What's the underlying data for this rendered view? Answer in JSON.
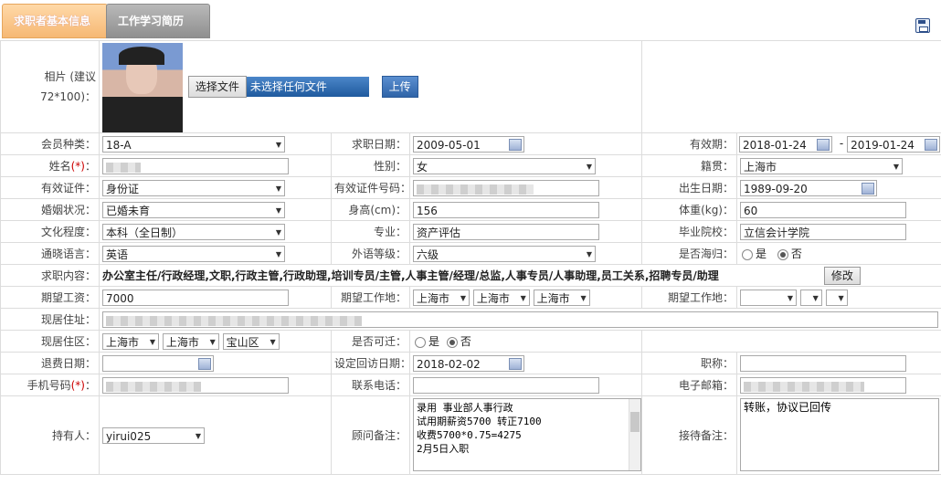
{
  "tabs": [
    {
      "label": "求职者基本信息"
    },
    {
      "label": "工作学习简历"
    }
  ],
  "photo": {
    "label": "相片 (建议",
    "label2": "72*100)：",
    "choose_file": "选择文件",
    "no_file": "未选择任何文件",
    "upload": "上传"
  },
  "fields": {
    "member_type": {
      "label": "会员种类：",
      "value": "18-A"
    },
    "apply_date": {
      "label": "求职日期：",
      "value": "2009-05-01"
    },
    "valid_period": {
      "label": "有效期：",
      "from": "2018-01-24",
      "sep": "-",
      "to": "2019-01-24"
    },
    "name": {
      "label": "姓名",
      "req": "(*)",
      "colon": "："
    },
    "gender": {
      "label": "性别：",
      "value": "女"
    },
    "origin": {
      "label": "籍贯：",
      "value": "上海市"
    },
    "id_type": {
      "label": "有效证件：",
      "value": "身份证"
    },
    "id_number": {
      "label": "有效证件号码："
    },
    "birth": {
      "label": "出生日期：",
      "value": "1989-09-20"
    },
    "marital": {
      "label": "婚姻状况：",
      "value": "已婚未育"
    },
    "height": {
      "label": "身高(cm)：",
      "value": "156"
    },
    "weight": {
      "label": "体重(kg)：",
      "value": "60"
    },
    "education": {
      "label": "文化程度：",
      "value": "本科（全日制）"
    },
    "major": {
      "label": "专业：",
      "value": "资产评估"
    },
    "school": {
      "label": "毕业院校：",
      "value": "立信会计学院"
    },
    "language": {
      "label": "通晓语言：",
      "value": "英语"
    },
    "foreign_level": {
      "label": "外语等级：",
      "value": "六级"
    },
    "returnee": {
      "label": "是否海归：",
      "yes": "是",
      "no": "否"
    },
    "job_content": {
      "label": "求职内容：",
      "value": "办公室主任/行政经理,文职,行政主管,行政助理,培训专员/主管,人事主管/经理/总监,人事专员/人事助理,员工关系,招聘专员/助理",
      "edit": "修改"
    },
    "expected_salary": {
      "label": "期望工资：",
      "value": "7000"
    },
    "expected_location": {
      "label": "期望工作地：",
      "v1": "上海市",
      "v2": "上海市",
      "v3": "上海市"
    },
    "expected_location2": {
      "label": "期望工作地："
    },
    "address": {
      "label": "现居住址："
    },
    "district": {
      "label": "现居住区：",
      "v1": "上海市",
      "v2": "上海市",
      "v3": "宝山区"
    },
    "relocate": {
      "label": "是否可迁：",
      "yes": "是",
      "no": "否"
    },
    "refund_date": {
      "label": "退费日期："
    },
    "callback_date": {
      "label": "设定回访日期：",
      "value": "2018-02-02"
    },
    "title": {
      "label": "职称："
    },
    "mobile": {
      "label": "手机号码",
      "req": "(*)",
      "colon": "："
    },
    "phone": {
      "label": "联系电话："
    },
    "email": {
      "label": "电子邮箱："
    },
    "owner": {
      "label": "持有人：",
      "value": "yirui025"
    },
    "consultant_note": {
      "label": "顾问备注：",
      "value": "录用 事业部人事行政\n试用期薪资5700 转正7100\n收费5700*0.75=4275\n2月5日入职"
    },
    "reception_note": {
      "label": "接待备注：",
      "value": "转账，协议已回传"
    }
  },
  "icons": [
    "save-icon",
    "calendar-icon",
    "dropdown-arrow-icon",
    "radio-icon"
  ]
}
